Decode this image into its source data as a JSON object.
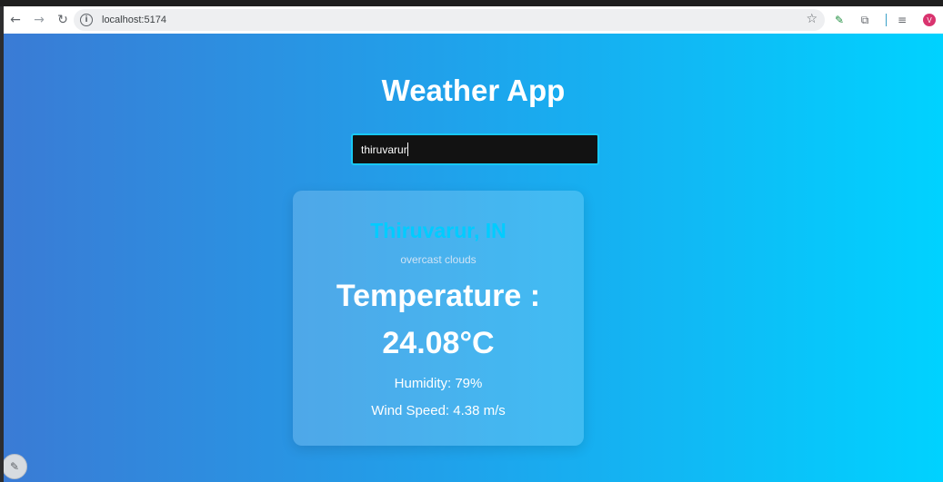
{
  "browser": {
    "back_icon": "←",
    "forward_icon": "→",
    "reload_icon": "↻",
    "info_icon": "i",
    "url": "localhost:5174",
    "star_icon": "☆",
    "ext_pen_icon": "✎",
    "ext_puzzle_icon": "⧉",
    "ext_media_icon": "≡",
    "avatar_letter": "V",
    "menu_icon": "⋮"
  },
  "app": {
    "title": "Weather App",
    "search": {
      "value": "thiruvarur"
    },
    "weather": {
      "city": "Thiruvarur, IN",
      "description": "overcast clouds",
      "temperature_label": "Temperature :",
      "temperature_value": "24.08°C",
      "humidity": "Humidity: 79%",
      "wind": "Wind Speed: 4.38 m/s"
    },
    "corner_icon": "✎"
  },
  "colors": {
    "gradient_start": "#3a7bd5",
    "gradient_end": "#00d2ff",
    "city_color": "#00ccff",
    "input_border": "#17c8f5",
    "input_bg": "#121212",
    "avatar_bg": "#d9346f"
  }
}
